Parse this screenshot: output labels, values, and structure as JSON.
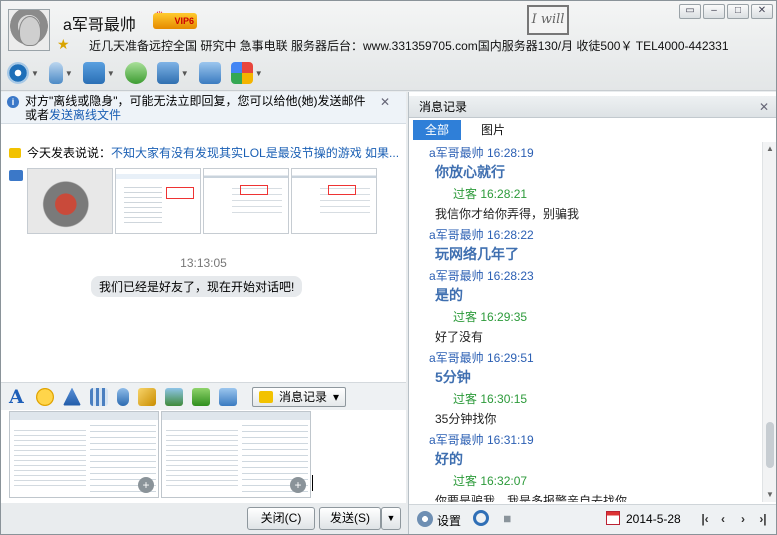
{
  "header": {
    "nickname": "a军哥最帅",
    "vip_badge": "VIP6",
    "signature": "近几天准备远控全国  研究中  急事电联  服务器后台：www.331359705.com国内服务器130/月 收徒500￥  TEL4000-442331",
    "decoration_text": "I will"
  },
  "left": {
    "notice_line1": "对方\"离线或隐身\"，可能无法立即回复，您可以给他(她)发送邮件",
    "notice_line2_prefix": "或者",
    "notice_link": "发送离线文件",
    "status_prefix": "今天发表说说：",
    "status_text": "不知大家有没有发现其实LOL是最没节操的游戏 如果...",
    "timestamp": "13:13:05",
    "system_message": "我们已经是好友了，现在开始对话吧!",
    "message_record_button": "消息记录",
    "close_button": "关闭(C)",
    "send_button": "发送(S)"
  },
  "right": {
    "title": "消息记录",
    "tabs": [
      "全部",
      "图片"
    ],
    "entries": [
      {
        "head": "a军哥最帅 16:28:19",
        "body": "你放心就行",
        "role": "me"
      },
      {
        "head": "过客 16:28:21",
        "body": "我信你才给你弄得，别骗我",
        "role": "guest"
      },
      {
        "head": "a军哥最帅 16:28:22",
        "body": "玩网络几年了",
        "role": "me"
      },
      {
        "head": "a军哥最帅 16:28:23",
        "body": "是的",
        "role": "me"
      },
      {
        "head": "过客 16:29:35",
        "body": "好了没有",
        "role": "guest"
      },
      {
        "head": "a军哥最帅 16:29:51",
        "body": "5分钟",
        "role": "me"
      },
      {
        "head": "过客 16:30:15",
        "body": "35分钟找你",
        "role": "guest"
      },
      {
        "head": "a军哥最帅 16:31:19",
        "body": "好的",
        "role": "me"
      },
      {
        "head": "过客 16:32:07",
        "body": "你要是骗我，我是多报警亲自去找你",
        "role": "guest"
      }
    ],
    "settings_label": "设置",
    "date": "2014-5-28"
  },
  "colors": {
    "accent": "#2f7fd8",
    "me_name": "#2b5fb3",
    "guest_name": "#2c9a3a",
    "message_big": "#3f6fb0"
  }
}
